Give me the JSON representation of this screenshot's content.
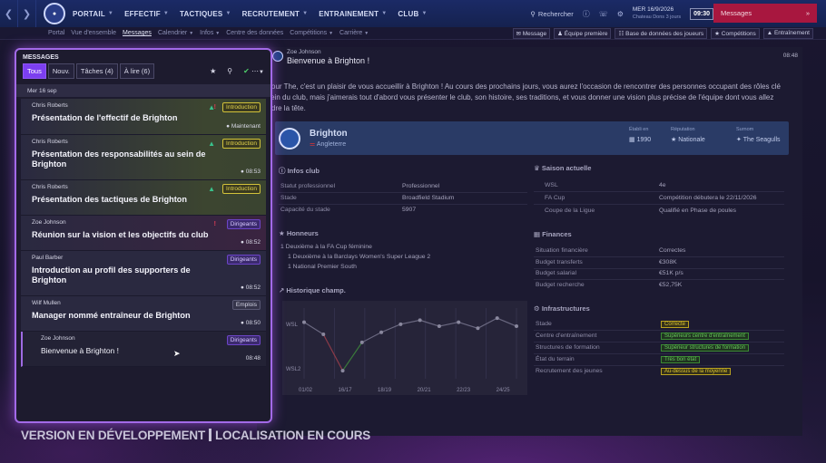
{
  "nav": {
    "items": [
      "PORTAIL",
      "EFFECTIF",
      "TACTIQUES",
      "RECRUTEMENT",
      "ENTRAINEMENT",
      "CLUB"
    ],
    "search": "Rechercher",
    "date": "MER 16/9/2026",
    "date_sub": "Chateau Dons 3 jours",
    "time": "09:30",
    "messages_button": "Messages"
  },
  "subnav": {
    "left": [
      "Portal",
      "Vue d'ensemble",
      "Messages",
      "Calendrier",
      "Infos",
      "Centre des données",
      "Compétitions",
      "Carrière"
    ],
    "right": [
      "Message",
      "Équipe première",
      "Base de données des joueurs",
      "Compétitions",
      "Entraînement"
    ]
  },
  "inbox": {
    "title": "MESSAGES",
    "filters": [
      "Tous",
      "Nouv.",
      "Tâches (4)",
      "À lire (6)"
    ],
    "date_header": "Mer 16 sep",
    "messages": [
      {
        "sender": "Chris Roberts",
        "subject": "Présentation de l'effectif de Brighton",
        "tag": "Introduction",
        "time": "Maintenant"
      },
      {
        "sender": "Chris Roberts",
        "subject": "Présentation des responsabilités au sein de Brighton",
        "tag": "Introduction",
        "time": "08:53"
      },
      {
        "sender": "Chris Roberts",
        "subject": "Présentation des tactiques de Brighton",
        "tag": "Introduction",
        "time": ""
      },
      {
        "sender": "Zoe Johnson",
        "subject": "Réunion sur la vision et les objectifs du club",
        "tag": "Dirigeants",
        "time": "08:52"
      },
      {
        "sender": "Paul Barber",
        "subject": "Introduction au profil des supporters de Brighton",
        "tag": "Dirigeants",
        "time": "08:52"
      },
      {
        "sender": "Wilf Mullen",
        "subject": "Manager nommé entraîneur de Brighton",
        "tag": "Emplois",
        "time": "08:50"
      },
      {
        "sender": "Zoe Johnson",
        "subject": "Bienvenue à Brighton !",
        "tag": "Dirigeants",
        "time": "08:48"
      }
    ]
  },
  "message": {
    "from": "Zoe Johnson",
    "title": "Bienvenue à Brighton !",
    "time": "08:48",
    "body": "Bonjour The, c'est un plaisir de vous accueillir à Brighton ! Au cours des prochains jours, vous aurez l'occasion de rencontrer des personnes occupant des rôles clé au sein du club, mais j'aimerais tout d'abord vous présenter le club, son histoire, ses traditions, et vous donner une vision plus précise de l'équipe dont vous allez prendre la tête.",
    "club": {
      "name": "Brighton",
      "country": "Angleterre",
      "founded_label": "Établi en",
      "founded": "1990",
      "reputation_label": "Réputation",
      "reputation": "Nationale",
      "nickname_label": "Surnom",
      "nickname": "The Seagulls"
    },
    "infos_club": {
      "title": "Infos club",
      "rows": [
        {
          "k": "Statut professionnel",
          "v": "Professionnel"
        },
        {
          "k": "Stade",
          "v": "Broadfield Stadium"
        },
        {
          "k": "Capacité du stade",
          "v": "5907"
        }
      ]
    },
    "honneurs": {
      "title": "Honneurs",
      "rows": [
        "1 Deuxième à la FA Cup féminine",
        "1 Deuxième à la Barclays Women's Super League 2",
        "1 National Premier South"
      ]
    },
    "historique": {
      "title": "Historique champ."
    },
    "saison": {
      "title": "Saison actuelle",
      "rows": [
        {
          "k": "WSL",
          "v": "4e"
        },
        {
          "k": "FA Cup",
          "v": "Compétition débutera le 22/11/2026"
        },
        {
          "k": "Coupe de la Ligue",
          "v": "Qualifié en Phase de poules"
        }
      ]
    },
    "finances": {
      "title": "Finances",
      "rows": [
        {
          "k": "Situation financière",
          "v": "Correctes"
        },
        {
          "k": "Budget transferts",
          "v": "€308K"
        },
        {
          "k": "Budget salarial",
          "v": "€51K p/s"
        },
        {
          "k": "Budget recherche",
          "v": "€52,75K"
        }
      ]
    },
    "infrastructures": {
      "title": "Infrastructures",
      "rows": [
        {
          "k": "Stade",
          "v": "Correcte"
        },
        {
          "k": "Centre d'entraînement",
          "v": "Supérieurs centre d'entraînement"
        },
        {
          "k": "Structures de formation",
          "v": "Supérieur structures de formation"
        },
        {
          "k": "État du terrain",
          "v": "Très bon état"
        },
        {
          "k": "Recrutement des jeunes",
          "v": "Au-dessus de la moyenne"
        }
      ]
    }
  },
  "chart_data": {
    "type": "line",
    "x": [
      "01/02",
      "16/17",
      "18/19",
      "20/21",
      "22/23",
      "24/25"
    ],
    "y_labels": [
      "WSL",
      "WSL2"
    ],
    "series": [
      {
        "values": [
          2.2,
          2.8,
          4.6,
          3.2,
          2.7,
          2.3,
          2.1,
          2.4,
          2.2,
          2.5,
          2.0,
          2.4
        ]
      }
    ],
    "x_positions": [
      0,
      1,
      2,
      3,
      4,
      5,
      6,
      7,
      8,
      9,
      10,
      11
    ]
  },
  "watermark": {
    "left": "VERSION EN DÉVELOPPEMENT",
    "right": "LOCALISATION EN COURS"
  },
  "colors": {
    "accent": "#7c3ff0",
    "panel_glow": "#a36ae8",
    "messages_button": "#a8173f"
  }
}
